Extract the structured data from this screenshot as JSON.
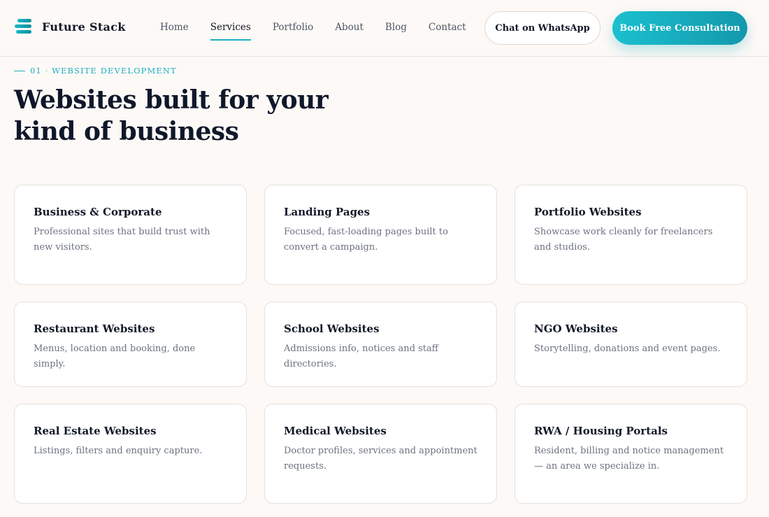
{
  "brand": {
    "name": "Future Stack",
    "icon": "stack-logo-icon",
    "accent": "#1cb0c4"
  },
  "nav": [
    {
      "label": "Home",
      "active": false
    },
    {
      "label": "Services",
      "active": true
    },
    {
      "label": "Portfolio",
      "active": false
    },
    {
      "label": "About",
      "active": false
    },
    {
      "label": "Blog",
      "active": false
    },
    {
      "label": "Contact",
      "active": false
    }
  ],
  "header_buttons": {
    "whatsapp_label": "Chat on WhatsApp",
    "consult_label": "Book Free Consultation"
  },
  "section": {
    "eyebrow": "01 · WEBSITE DEVELOPMENT",
    "title": "Websites built for your kind of business"
  },
  "cards": [
    {
      "title": "Business & Corporate",
      "desc": "Professional sites that build trust with new visitors."
    },
    {
      "title": "Landing Pages",
      "desc": "Focused, fast-loading pages built to convert a campaign."
    },
    {
      "title": "Portfolio Websites",
      "desc": "Showcase work cleanly for freelancers and studios."
    },
    {
      "title": "Restaurant Websites",
      "desc": "Menus, location and booking, done simply."
    },
    {
      "title": "School Websites",
      "desc": "Admissions info, notices and staff directories."
    },
    {
      "title": "NGO Websites",
      "desc": "Storytelling, donations and event pages."
    },
    {
      "title": "Real Estate Websites",
      "desc": "Listings, filters and enquiry capture."
    },
    {
      "title": "Medical Websites",
      "desc": "Doctor profiles, services and appointment requests."
    },
    {
      "title": "RWA / Housing Portals",
      "desc": "Resident, billing and notice management — an area we specialize in."
    }
  ]
}
